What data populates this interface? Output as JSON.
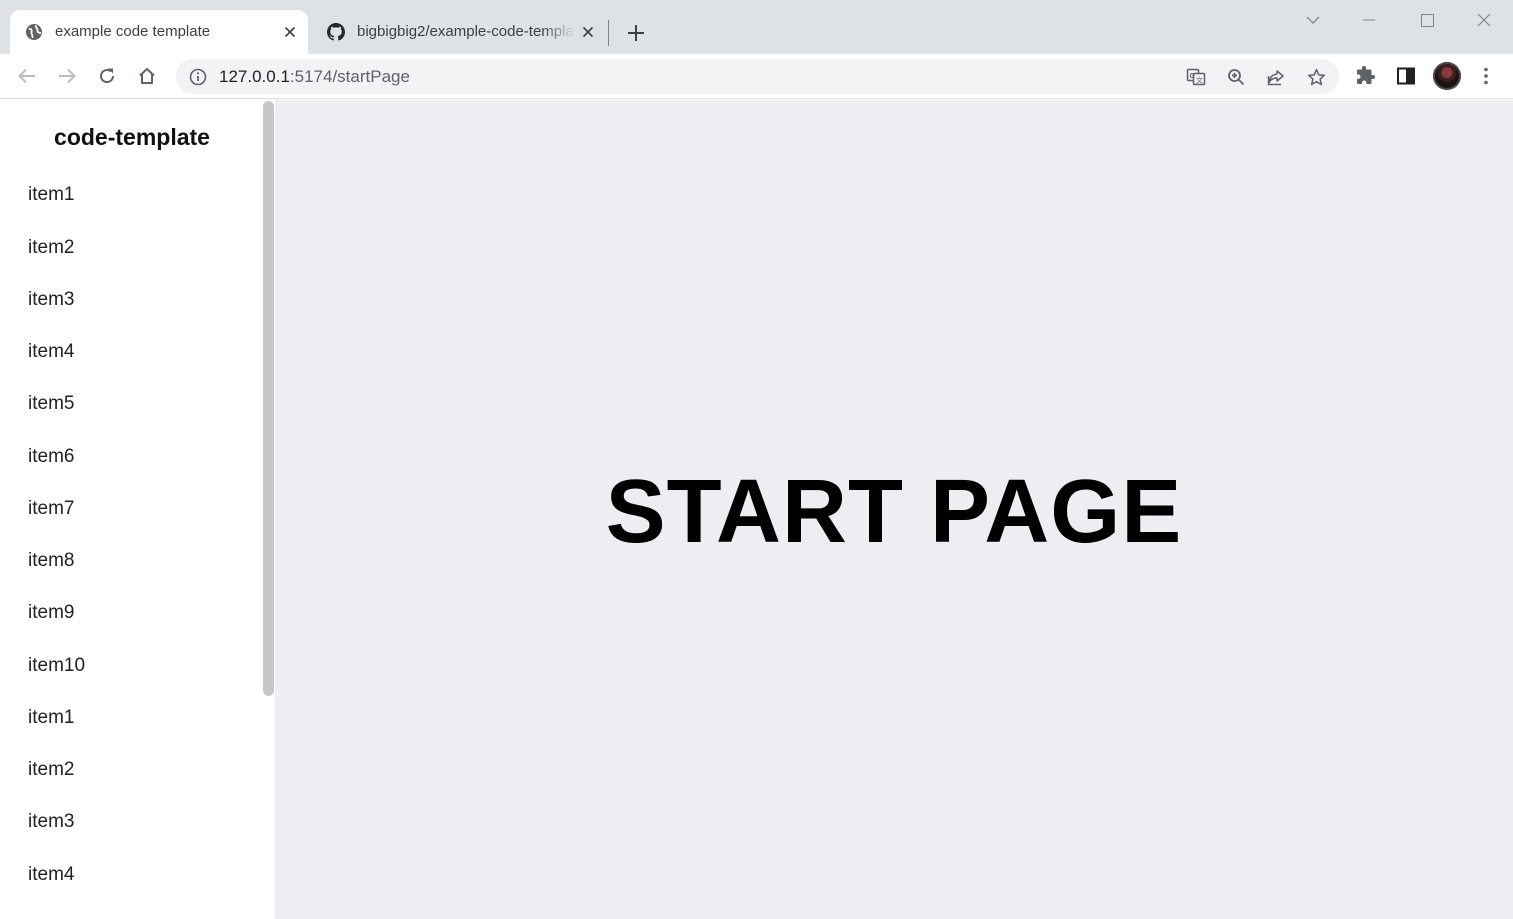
{
  "browser": {
    "tabs": [
      {
        "title": "example code template",
        "favicon": "globe-icon",
        "active": true
      },
      {
        "title": "bigbigbig2/example-code-template",
        "favicon": "github-icon",
        "active": false
      }
    ],
    "address": {
      "host": "127.0.0.1",
      "path": ":5174/startPage"
    }
  },
  "sidebar": {
    "title": "code-template",
    "items": [
      "item1",
      "item2",
      "item3",
      "item4",
      "item5",
      "item6",
      "item7",
      "item8",
      "item9",
      "item10",
      "item1",
      "item2",
      "item3",
      "item4"
    ]
  },
  "main": {
    "headline": "START PAGE"
  },
  "colors": {
    "tabstrip": "#dee1e6",
    "content_bg": "#edeef2",
    "sidebar_bg": "#ffffff",
    "scrollbar": "#c7c7c7"
  }
}
